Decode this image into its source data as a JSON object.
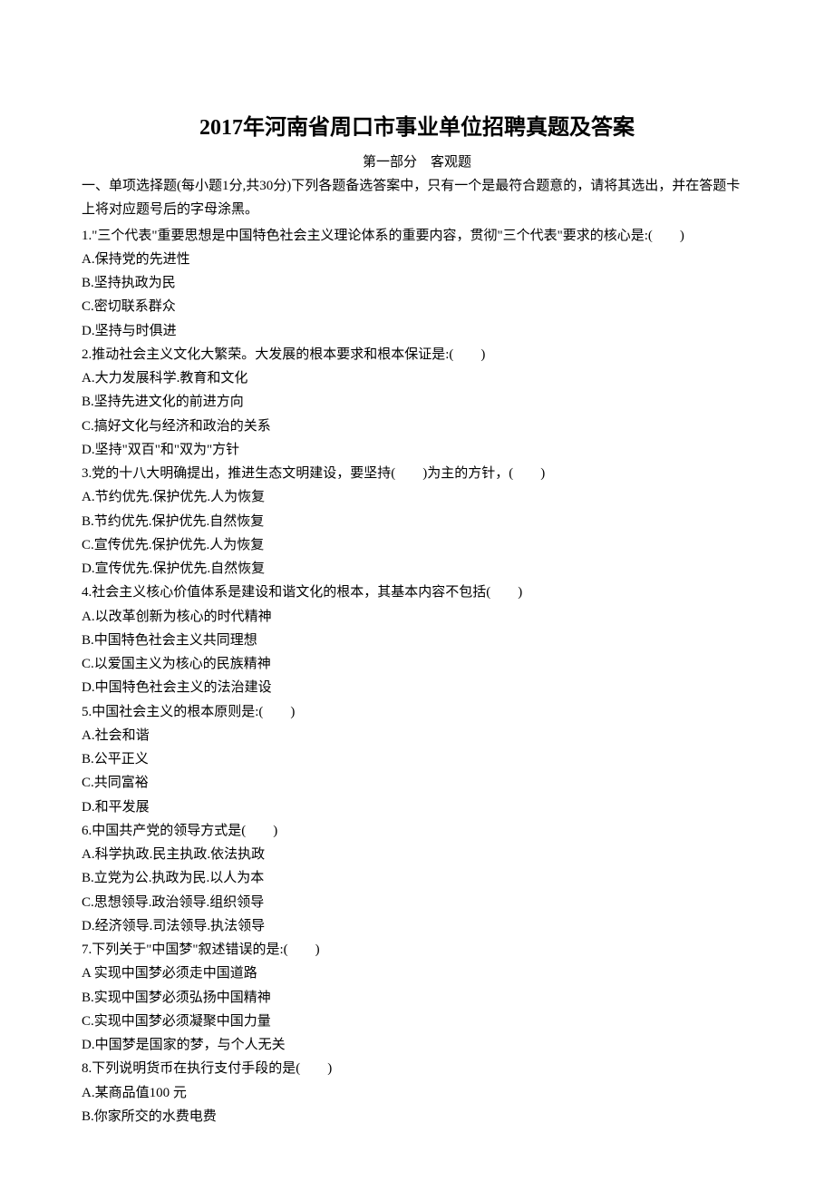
{
  "title": "2017年河南省周口市事业单位招聘真题及答案",
  "section_header": "第一部分　客观题",
  "instructions": "一、单项选择题(每小题1分,共30分)下列各题备选答案中，只有一个是最符合题意的，请将其选出，并在答题卡上将对应题号后的字母涂黑。",
  "questions": [
    {
      "q": "1.\"三个代表\"重要思想是中国特色社会主义理论体系的重要内容，贯彻\"三个代表\"要求的核心是:(　　)",
      "opts": [
        "A.保持党的先进性",
        "B.坚持执政为民",
        "C.密切联系群众",
        "D.坚持与时俱进"
      ]
    },
    {
      "q": "2.推动社会主义文化大繁荣。大发展的根本要求和根本保证是:(　　)",
      "opts": [
        "A.大力发展科学.教育和文化",
        "B.坚持先进文化的前进方向",
        "C.搞好文化与经济和政治的关系",
        "D.坚持\"双百\"和\"双为\"方针"
      ]
    },
    {
      "q": "3.党的十八大明确提出，推进生态文明建设，要坚持(　　)为主的方针，(　　)",
      "opts": [
        "A.节约优先.保护优先.人为恢复",
        "B.节约优先.保护优先.自然恢复",
        "C.宣传优先.保护优先.人为恢复",
        "D.宣传优先.保护优先.自然恢复"
      ]
    },
    {
      "q": "4.社会主义核心价值体系是建设和谐文化的根本，其基本内容不包括(　　)",
      "opts": [
        "A.以改革创新为核心的时代精神",
        "B.中国特色社会主义共同理想",
        "C.以爱国主义为核心的民族精神",
        "D.中国特色社会主义的法治建设"
      ]
    },
    {
      "q": "5.中国社会主义的根本原则是:(　　)",
      "opts": [
        "A.社会和谐",
        "B.公平正义",
        "C.共同富裕",
        "D.和平发展"
      ]
    },
    {
      "q": "6.中国共产党的领导方式是(　　)",
      "opts": [
        "A.科学执政.民主执政.依法执政",
        "B.立党为公.执政为民.以人为本",
        "C.思想领导.政治领导.组织领导",
        "D.经济领导.司法领导.执法领导"
      ]
    },
    {
      "q": "7.下列关于\"中国梦\"叙述错误的是:(　　)",
      "opts": [
        "A 实现中国梦必须走中国道路",
        "B.实现中国梦必须弘扬中国精神",
        "C.实现中国梦必须凝聚中国力量",
        "D.中国梦是国家的梦，与个人无关"
      ]
    },
    {
      "q": "8.下列说明货币在执行支付手段的是(　　)",
      "opts": [
        "A.某商品值100 元",
        "B.你家所交的水费电费"
      ]
    }
  ]
}
